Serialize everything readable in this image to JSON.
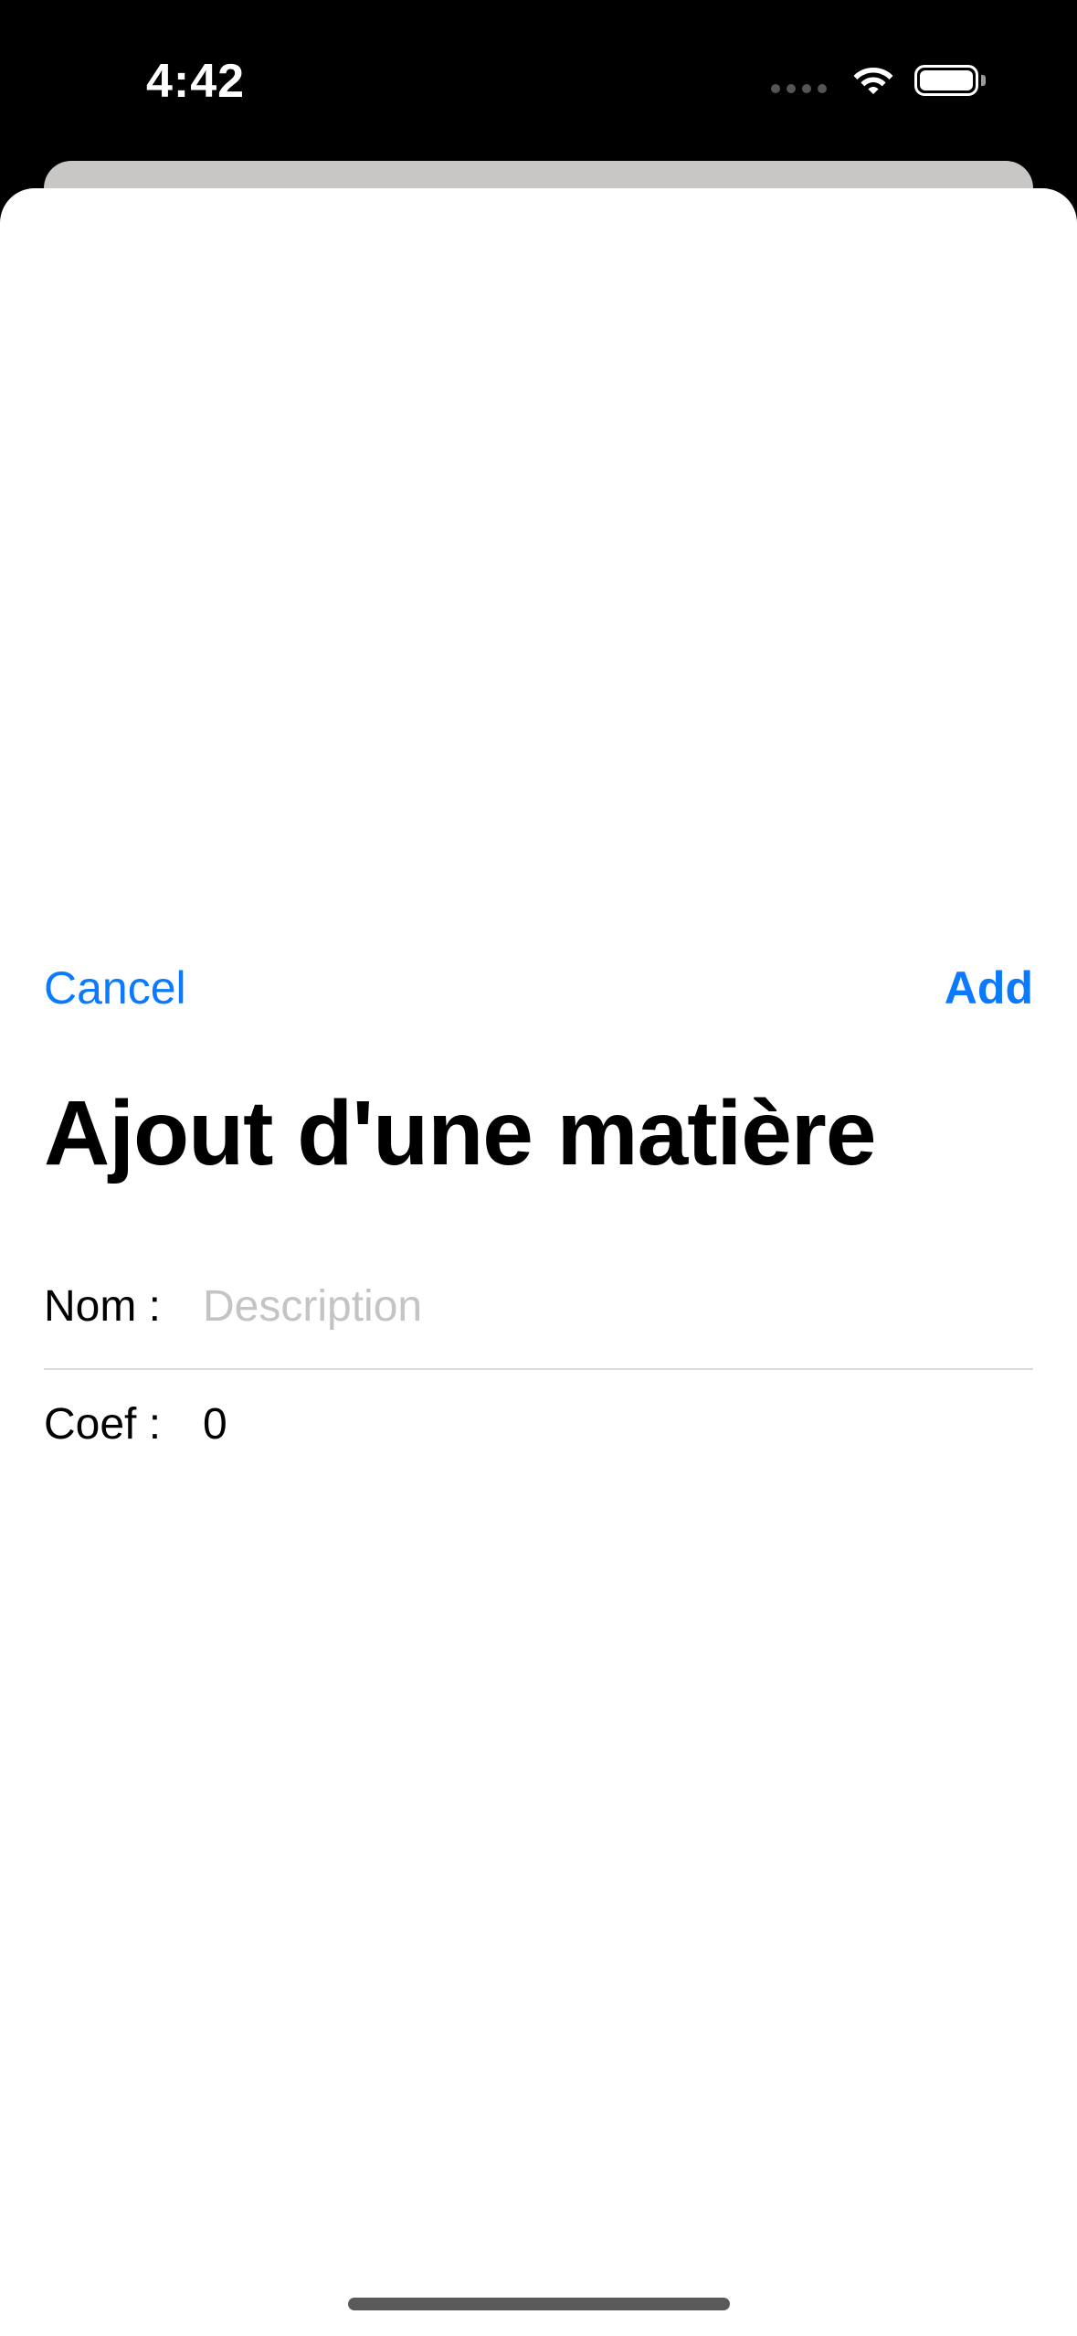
{
  "status_bar": {
    "time": "4:42",
    "icons": [
      "cellular-signal-icon",
      "wifi-icon",
      "battery-icon"
    ]
  },
  "nav": {
    "cancel_label": "Cancel",
    "add_label": "Add"
  },
  "title": "Ajout d'une matière",
  "form": {
    "nom": {
      "label": "Nom :",
      "value": "",
      "placeholder": "Description"
    },
    "coef": {
      "label": "Coef :",
      "value": "0"
    }
  },
  "colors": {
    "accent": "#0a7aff",
    "status_bar_bg": "#000000",
    "sheet_bg": "#ffffff",
    "placeholder": "#c4c4c6",
    "back_card": "#c8c7c5"
  }
}
